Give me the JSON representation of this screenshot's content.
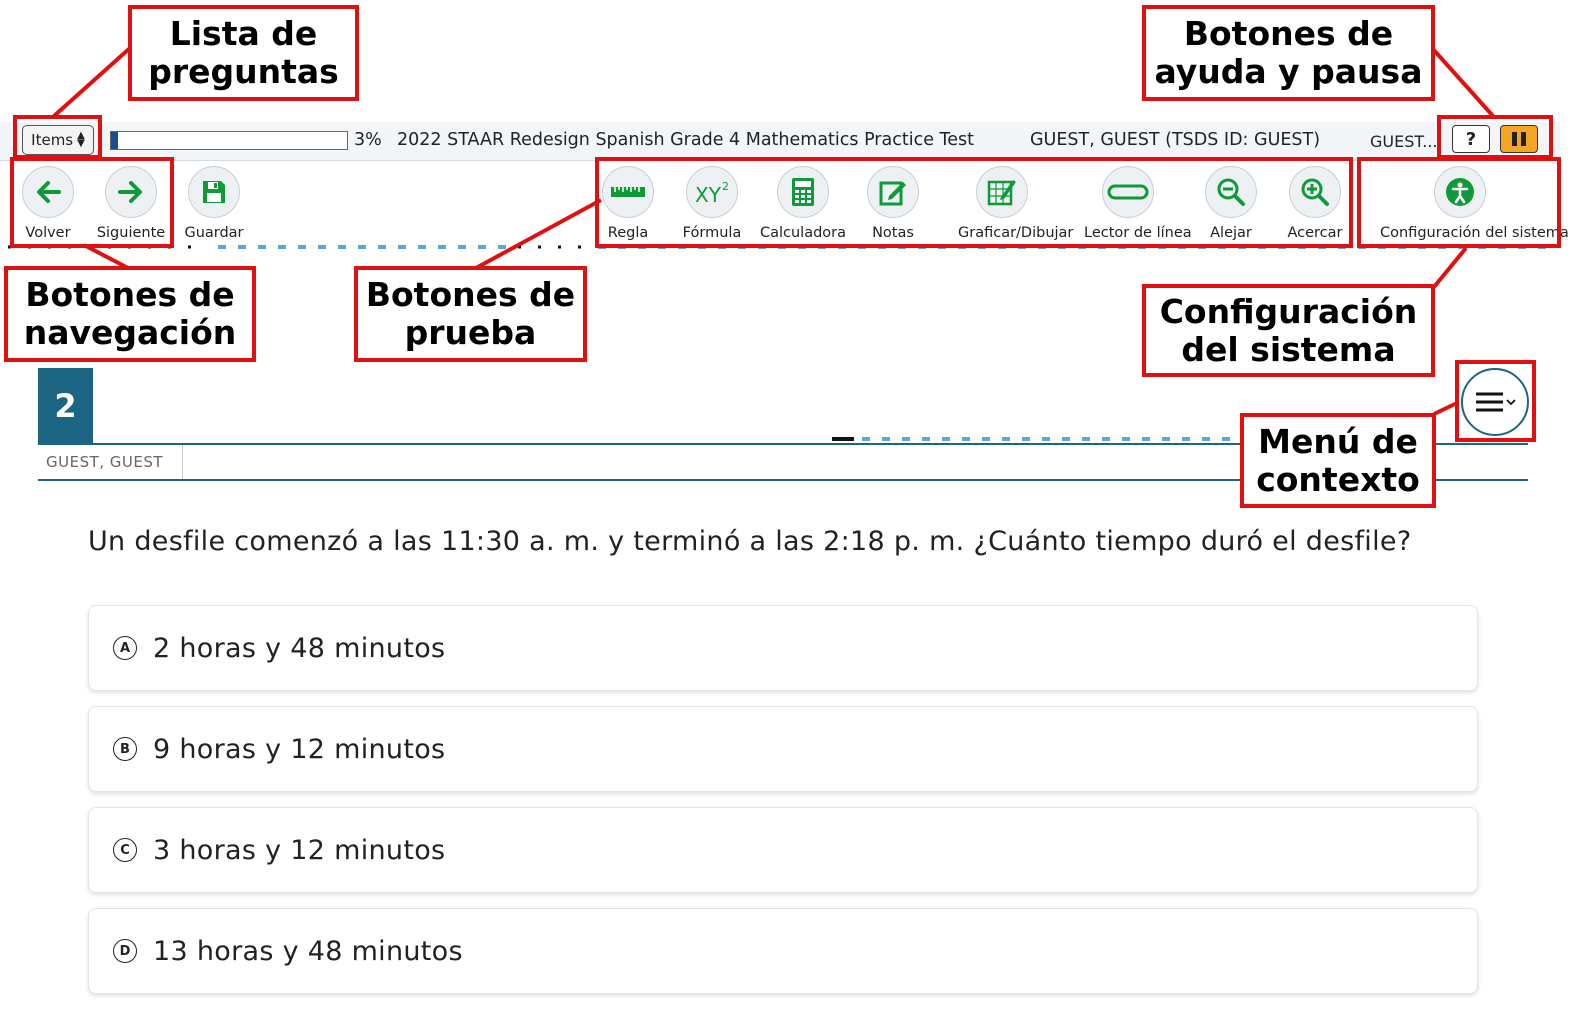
{
  "topbar": {
    "items_label": "Items",
    "progress_percent": 3,
    "progress_text": "3%",
    "test_title": "2022 STAAR Redesign Spanish Grade 4 Mathematics Practice Test",
    "student": "GUEST, GUEST (TSDS ID: GUEST)",
    "session": "GUEST...",
    "help_label": "?"
  },
  "nav": {
    "back": "Volver",
    "next": "Siguiente",
    "save": "Guardar"
  },
  "tools": {
    "ruler": "Regla",
    "formula": "Fórmula",
    "calculator": "Calculadora",
    "notes": "Notas",
    "graph": "Graficar/Dibujar",
    "line_reader": "Lector de línea",
    "zoom_out": "Alejar",
    "zoom_in": "Acercar",
    "settings": "Configuración del sistema"
  },
  "annotations": {
    "items_list": "Lista de\npreguntas",
    "help_pause": "Botones de\nayuda y pausa",
    "navigation": "Botones de\nnavegación",
    "test_tools": "Botones de\nprueba",
    "system_settings": "Configuración\ndel sistema",
    "context_menu": "Menú de\ncontexto"
  },
  "question": {
    "number": "2",
    "student_tab": "GUEST, GUEST",
    "stem": "Un desfile comenzó a las 11:30 a. m. y terminó a las 2:18 p. m. ¿Cuánto tiempo duró el desfile?",
    "options": [
      {
        "letter": "A",
        "text": "2 horas y 48 minutos"
      },
      {
        "letter": "B",
        "text": "9 horas y 12 minutos"
      },
      {
        "letter": "C",
        "text": "3 horas y 12 minutos"
      },
      {
        "letter": "D",
        "text": "13 horas y 48 minutos"
      }
    ]
  },
  "colors": {
    "accent": "#1c6583",
    "tool_green": "#0f9a3a",
    "annotation_red": "#e01010",
    "pause_orange": "#f5a623"
  }
}
